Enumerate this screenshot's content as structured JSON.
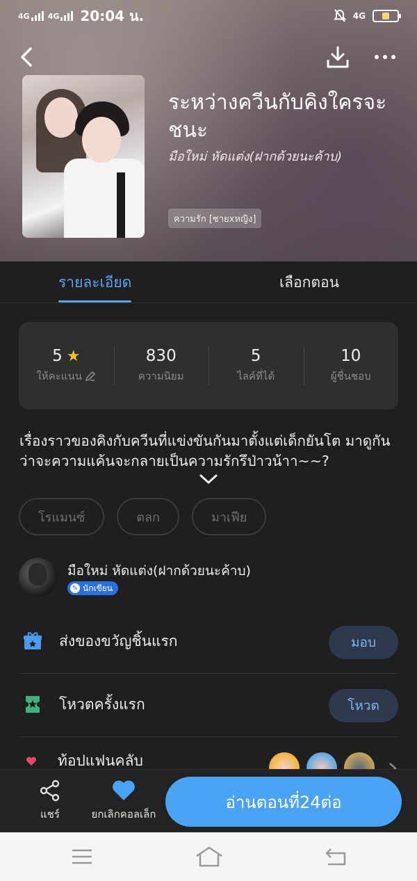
{
  "status": {
    "signal1": "4G",
    "signal2": "4G",
    "time": "20:04 น.",
    "net": "4G"
  },
  "book": {
    "title": "ระหว่างควีนกับคิงใครจะชนะ",
    "author": "มือใหม่ หัดแต่ง(ฝากด้วยนะค้าบ)",
    "genre": "ความรัก [ชายxหญิง]"
  },
  "tabs": {
    "details": "รายละเอียด",
    "episodes": "เลือกตอน"
  },
  "stats": [
    {
      "value": "5",
      "label": "ให้คะแนน"
    },
    {
      "value": "830",
      "label": "ความนิยม"
    },
    {
      "value": "5",
      "label": "ไลค์ที่ได้"
    },
    {
      "value": "10",
      "label": "ผู้ชื่นชอบ"
    }
  ],
  "synopsis": "เรื่องราวของคิงกับควีนที่แข่งขันกันมาตั้งแต่เด็กยันโต มาดูกันว่าจะความแค้นจะกลายเป็นความรักรึป่าวน้าา~~?",
  "tags": [
    "โรแมนซ์",
    "ตลก",
    "มาเฟีย"
  ],
  "author_row": {
    "name": "มือใหม่ หัดแต่ง(ฝากด้วยนะค้าบ)",
    "badge": "นักเขียน"
  },
  "gift": {
    "label": "ส่งของขวัญชิ้นแรก",
    "button": "มอบ"
  },
  "vote": {
    "label": "โหวตครั้งแรก",
    "button": "โหวต"
  },
  "fanclub": {
    "label": "ท้อปแฟนคลับ"
  },
  "bottom": {
    "share": "แชร์",
    "collect": "ยกเลิกคอลเล็ก",
    "read": "อ่านตอนที่24ต่อ"
  },
  "colors": {
    "accent": "#4aa3f4",
    "star": "#f6c12b",
    "badge": "#2a6fe0"
  }
}
